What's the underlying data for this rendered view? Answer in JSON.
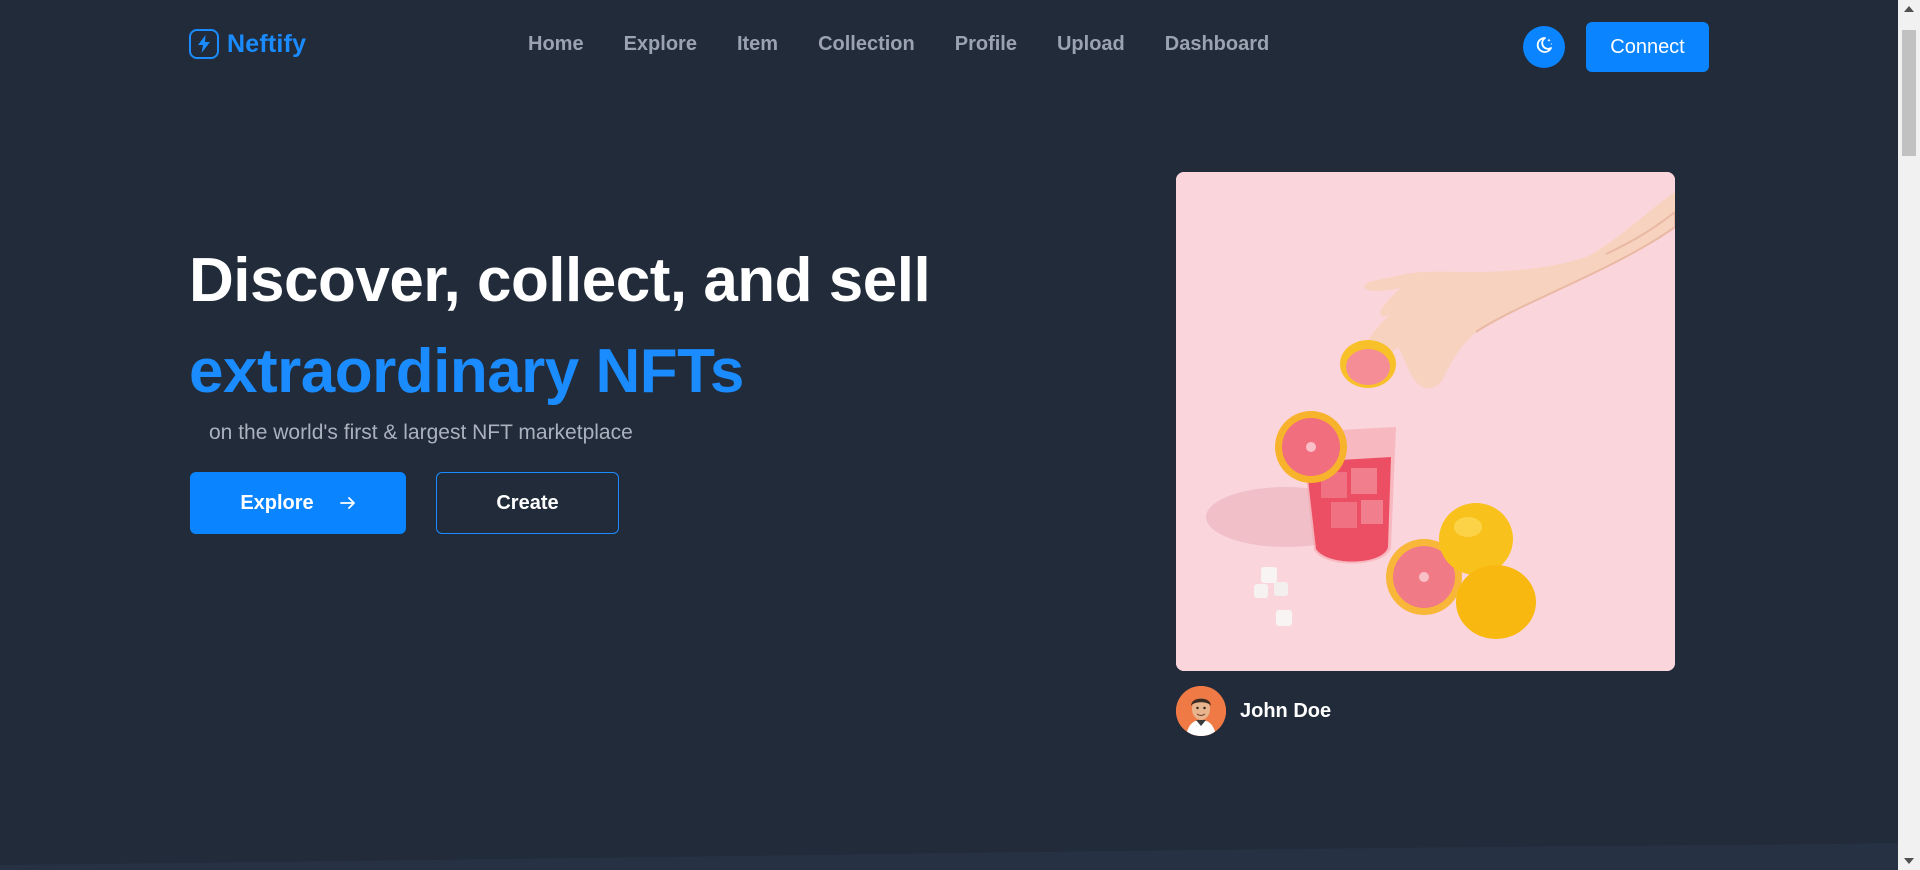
{
  "header": {
    "brand_name": "Neftify",
    "brand_icon": "lightning-bolt-icon",
    "nav": [
      {
        "label": "Home"
      },
      {
        "label": "Explore"
      },
      {
        "label": "Item"
      },
      {
        "label": "Collection"
      },
      {
        "label": "Profile"
      },
      {
        "label": "Upload"
      },
      {
        "label": "Dashboard"
      }
    ],
    "theme_toggle_icon": "moon-stars-icon",
    "connect_label": "Connect"
  },
  "hero": {
    "title": "Discover, collect, and sell",
    "title_accent": "extraordinary NFTs",
    "subtitle": "on the world's first & largest NFT marketplace",
    "explore_label": "Explore",
    "explore_icon": "arrow-right-icon",
    "create_label": "Create"
  },
  "featured": {
    "creator_name": "John Doe"
  },
  "colors": {
    "background": "#212b3a",
    "accent": "#0a84ff",
    "brand": "#1a8cff",
    "nav_text": "#9aa3af",
    "nft_bg": "#fbd5dc"
  }
}
